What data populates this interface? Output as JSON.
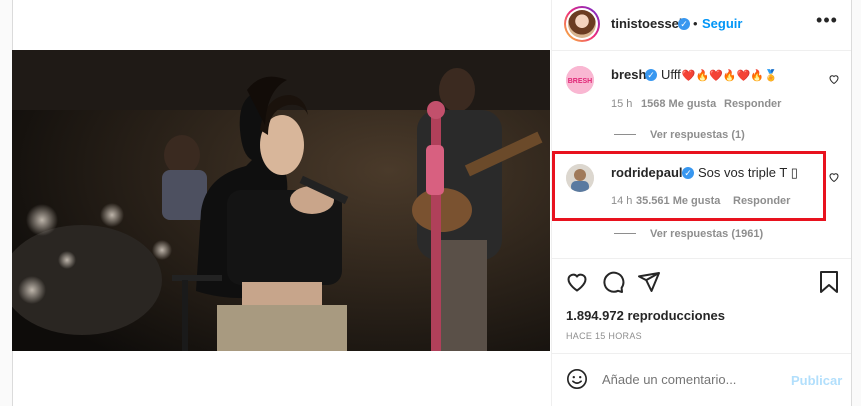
{
  "header": {
    "username": "tinistoessel",
    "separator": "•",
    "follow_label": "Seguir",
    "more_glyph": "•••"
  },
  "comments": [
    {
      "username": "bresh",
      "text": "Ufff",
      "emojis": "❤️🔥❤️🔥❤️🔥🏅",
      "time": "15 h",
      "likes": "1568 Me gusta",
      "reply_label": "Responder",
      "view_replies": "Ver respuestas (1)"
    },
    {
      "username": "rodridepaul",
      "text": "Sos vos triple T ▯",
      "time": "14 h",
      "likes": "35.561 Me gusta",
      "reply_label": "Responder",
      "view_replies": "Ver respuestas (1961)"
    }
  ],
  "stats": {
    "views": "1.894.972 reproducciones",
    "posted_ago": "HACE 15 HORAS"
  },
  "composer": {
    "placeholder": "Añade un comentario...",
    "post_label": "Publicar"
  },
  "colors": {
    "accent": "#0095f6",
    "highlight": "#e8121e",
    "verified": "#3897f0"
  }
}
